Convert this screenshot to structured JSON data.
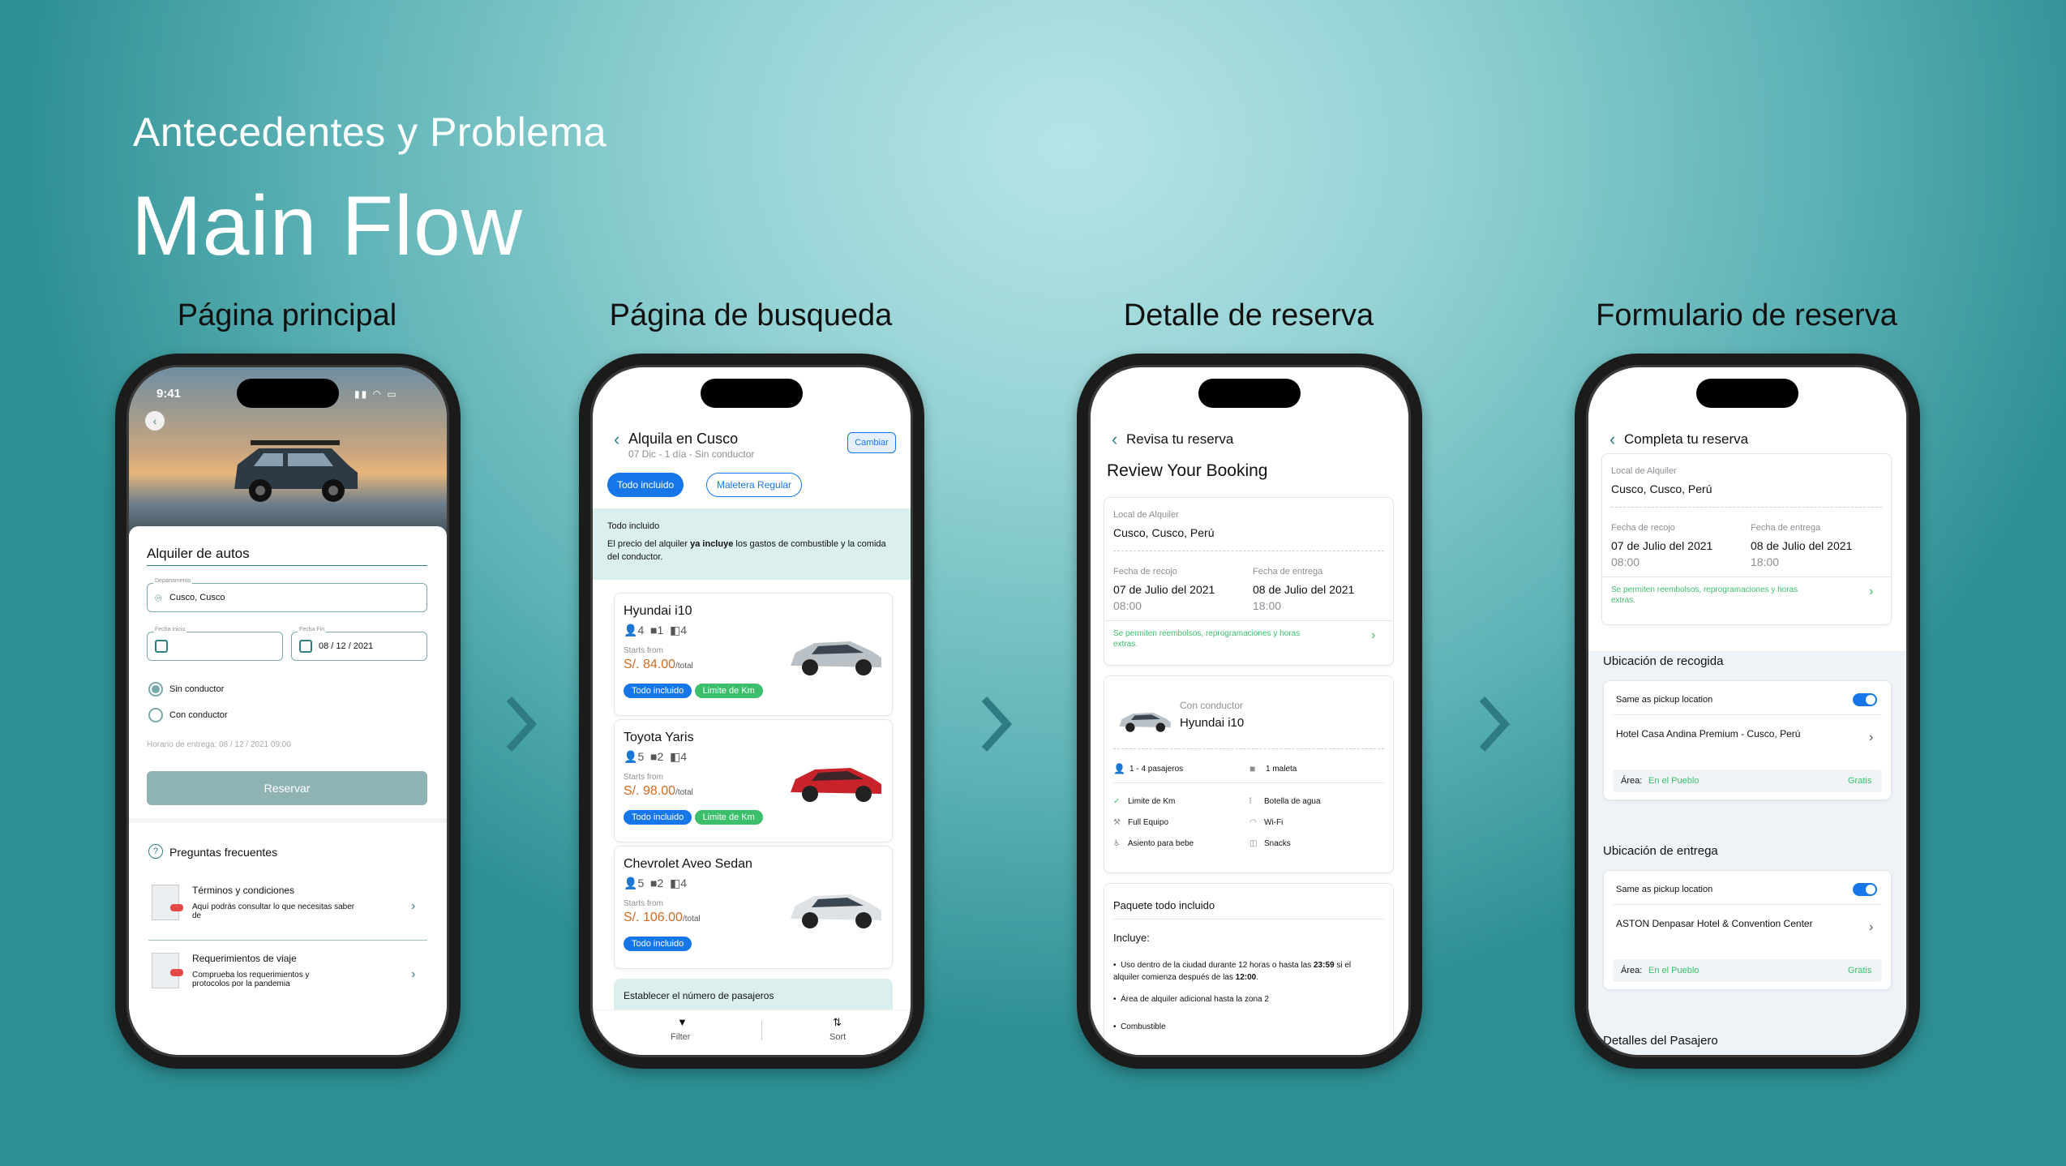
{
  "header": {
    "subtitle": "Antecedentes y Problema",
    "title": "Main Flow"
  },
  "phones": {
    "p1": {
      "title": "Página principal",
      "status_time": "9:41",
      "card_title": "Alquiler de autos",
      "dept_label": "Departamento",
      "dept_value": "Cusco, Cusco",
      "start_label": "Fecha inicio",
      "end_label": "Fecha Fin",
      "end_value": "08 / 12 / 2021",
      "radio1": "Sin conductor",
      "radio2": "Con conductor",
      "delivery": "Horario de entrega: 08 / 12 / 2021 09:00",
      "reserve": "Reservar",
      "faq_title": "Preguntas frecuentes",
      "faq": [
        {
          "title": "Términos y condiciones",
          "desc": "Aquí podrás consultar lo que necesitas saber de"
        },
        {
          "title": "Requerimientos de viaje",
          "desc": "Comprueba los requerimientos y protocolos por la pandemia"
        }
      ]
    },
    "p2": {
      "title": "Página de busqueda",
      "header_title": "Alquila en Cusco",
      "header_sub": "07 Dic - 1 día - Sin conductor",
      "change": "Cambiar",
      "chip1": "Todo incluido",
      "chip2": "Maletera Regular",
      "info_title": "Todo incluido",
      "info_text_a": "El precio del alquiler ",
      "info_text_b": "ya incluye",
      "info_text_c": " los gastos de combustible y la comida del conductor.",
      "cars": [
        {
          "name": "Hyundai i10",
          "seats": "4",
          "bags": "1",
          "doors": "4",
          "starts": "Starts from",
          "price": "S/. 84.00",
          "unit": "/total",
          "tags": [
            "Todo incluido",
            "Limite de Km"
          ]
        },
        {
          "name": "Toyota Yaris",
          "seats": "5",
          "bags": "2",
          "doors": "4",
          "starts": "Starts from",
          "price": "S/. 98.00",
          "unit": "/total",
          "tags": [
            "Todo incluido",
            "Limite de Km"
          ]
        },
        {
          "name": "Chevrolet Aveo Sedan",
          "seats": "5",
          "bags": "2",
          "doors": "4",
          "starts": "Starts from",
          "price": "S/. 106.00",
          "unit": "/total",
          "tags": [
            "Todo incluido"
          ]
        }
      ],
      "passengers": "Establecer el número de pasajeros",
      "filter": "Filter",
      "sort": "Sort"
    },
    "p3": {
      "title": "Detalle de reserva",
      "header": "Revisa tu reserva",
      "heading": "Review Your Booking",
      "local_label": "Local de Alquiler",
      "local_value": "Cusco, Cusco, Perú",
      "pick_label": "Fecha de recojo",
      "pick_date": "07 de Julio del 2021",
      "pick_time": "08:00",
      "drop_label": "Fecha de entrega",
      "drop_date": "08 de Julio del 2021",
      "drop_time": "18:00",
      "refund": "Se permiten reembolsos, reprogramaciones y horas extras.",
      "driver": "Con conductor",
      "car": "Hyundai i10",
      "pax": "1 - 4 pasajeros",
      "bags": "1 maleta",
      "features": [
        "Limite de Km",
        "Botella de agua",
        "Full Equipo",
        "Wi-Fi",
        "Asiento para bebe",
        "Snacks"
      ],
      "package": "Paquete todo incluido",
      "includes": "Incluye:",
      "bullet1_a": "Uso dentro de la ciudad durante 12 horas o hasta las ",
      "bullet1_b": "23:59",
      "bullet1_c": " si el alquiler comienza después de las ",
      "bullet1_d": "12:00",
      "bullet1_e": ".",
      "bullet2": "Área de alquiler adicional hasta la zona 2",
      "bullet3": "Combustible"
    },
    "p4": {
      "title": "Formulario de reserva",
      "header": "Completa tu reserva",
      "local_label": "Local de Alquiler",
      "local_value": "Cusco, Cusco, Perú",
      "pick_label": "Fecha de recojo",
      "pick_date": "07 de Julio del 2021",
      "pick_time": "08:00",
      "drop_label": "Fecha de entrega",
      "drop_date": "08 de Julio del 2021",
      "drop_time": "18:00",
      "refund": "Se permiten reembolsos, reprogramaciones y horas extras.",
      "pickup_section": "Ubicación de recogida",
      "same": "Same as pickup location",
      "pickup_hotel": "Hotel Casa Andina Premium - Cusco, Perú",
      "area_label": "Área:",
      "area_value": "En el Pueblo",
      "free": "Gratis",
      "drop_section": "Ubicación de entrega",
      "drop_hotel": "ASTON Denpasar Hotel & Convention Center",
      "passenger": "Detalles del Pasajero"
    }
  },
  "colors": {
    "primary": "#1877e8",
    "green": "#3bbf6a",
    "teal": "#2f7f86",
    "price": "#d2691e"
  }
}
